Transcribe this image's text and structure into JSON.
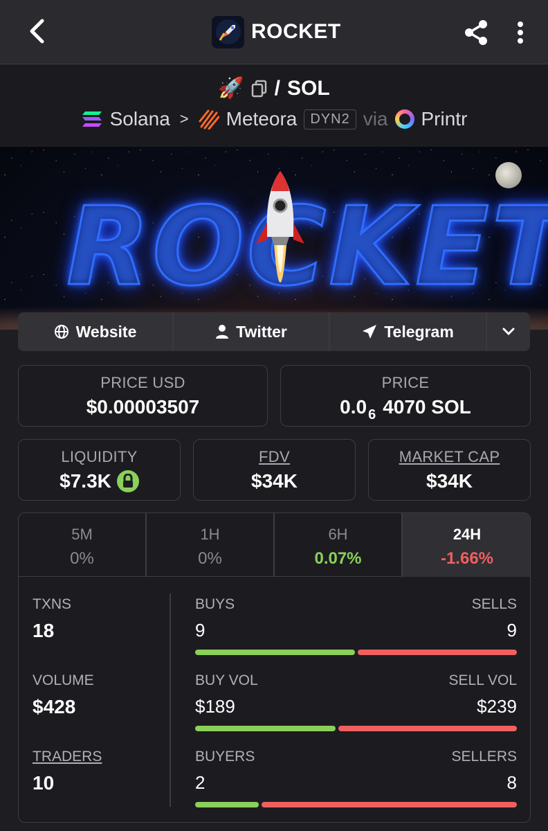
{
  "header": {
    "title": "ROCKET",
    "back_icon": "chevron-left-icon",
    "share_icon": "share-icon",
    "more_icon": "more-vertical-icon"
  },
  "pair": {
    "base_emoji": "🚀",
    "separator": "/",
    "quote": "SOL",
    "chain": "Solana",
    "dex": "Meteora",
    "dex_badge": "DYN2",
    "via_label": "via",
    "launchpad": "Printr"
  },
  "banner": {
    "title": "ROCKET"
  },
  "links": {
    "website": "Website",
    "twitter": "Twitter",
    "telegram": "Telegram"
  },
  "prices": {
    "price_usd_label": "PRICE USD",
    "price_usd": "$0.00003507",
    "price_label": "PRICE",
    "price_sol_prefix": "0.0",
    "price_sol_zeros": "6",
    "price_sol_suffix": "4070 SOL"
  },
  "metrics": {
    "liquidity_label": "LIQUIDITY",
    "liquidity": "$7.3K",
    "fdv_label": "FDV",
    "fdv": "$34K",
    "mcap_label": "MARKET CAP",
    "mcap": "$34K"
  },
  "timeframes": [
    {
      "label": "5M",
      "value": "0%"
    },
    {
      "label": "1H",
      "value": "0%"
    },
    {
      "label": "6H",
      "value": "0.07%"
    },
    {
      "label": "24H",
      "value": "-1.66%"
    }
  ],
  "stats": {
    "txns_label": "TXNS",
    "txns": "18",
    "volume_label": "VOLUME",
    "volume": "$428",
    "traders_label": "TRADERS",
    "traders": "10",
    "buys_label": "BUYS",
    "buys": "9",
    "sells_label": "SELLS",
    "sells": "9",
    "buy_vol_label": "BUY VOL",
    "buy_vol": "$189",
    "sell_vol_label": "SELL VOL",
    "sell_vol": "$239",
    "buyers_label": "BUYERS",
    "buyers": "2",
    "sellers_label": "SELLERS",
    "sellers": "8"
  },
  "ratios": {
    "buys_share": 0.5,
    "buy_vol_share": 0.44,
    "buyers_share": 0.2
  },
  "colors": {
    "positive": "#8bd05a",
    "negative": "#f06060",
    "background": "#1e1e22"
  }
}
